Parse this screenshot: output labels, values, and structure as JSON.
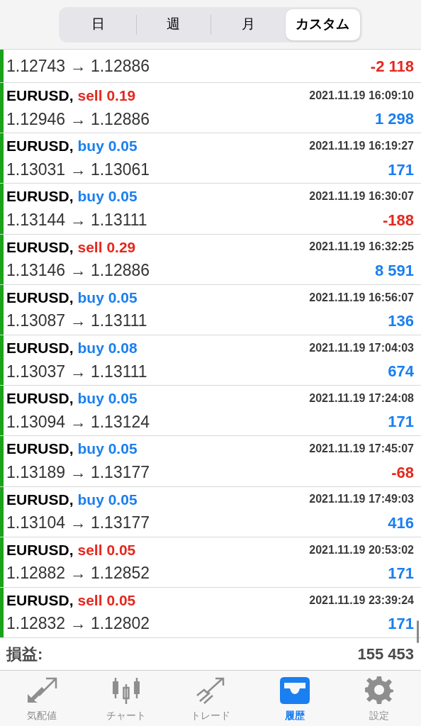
{
  "segments": [
    {
      "label": "日",
      "selected": false
    },
    {
      "label": "週",
      "selected": false
    },
    {
      "label": "月",
      "selected": false
    },
    {
      "label": "カスタム",
      "selected": true
    }
  ],
  "first_row": {
    "prices": "1.12743 → 1.12886",
    "profit": "-2 118",
    "loss": true
  },
  "trades": [
    {
      "symbol": "EURUSD,",
      "order": "sell 0.19",
      "kind": "sell",
      "time": "2021.11.19 16:09:10",
      "prices": "1.12946 → 1.12886",
      "profit": "1 298",
      "loss": false
    },
    {
      "symbol": "EURUSD,",
      "order": "buy 0.05",
      "kind": "buy",
      "time": "2021.11.19 16:19:27",
      "prices": "1.13031 → 1.13061",
      "profit": "171",
      "loss": false
    },
    {
      "symbol": "EURUSD,",
      "order": "buy 0.05",
      "kind": "buy",
      "time": "2021.11.19 16:30:07",
      "prices": "1.13144 → 1.13111",
      "profit": "-188",
      "loss": true
    },
    {
      "symbol": "EURUSD,",
      "order": "sell 0.29",
      "kind": "sell",
      "time": "2021.11.19 16:32:25",
      "prices": "1.13146 → 1.12886",
      "profit": "8 591",
      "loss": false
    },
    {
      "symbol": "EURUSD,",
      "order": "buy 0.05",
      "kind": "buy",
      "time": "2021.11.19 16:56:07",
      "prices": "1.13087 → 1.13111",
      "profit": "136",
      "loss": false
    },
    {
      "symbol": "EURUSD,",
      "order": "buy 0.08",
      "kind": "buy",
      "time": "2021.11.19 17:04:03",
      "prices": "1.13037 → 1.13111",
      "profit": "674",
      "loss": false
    },
    {
      "symbol": "EURUSD,",
      "order": "buy 0.05",
      "kind": "buy",
      "time": "2021.11.19 17:24:08",
      "prices": "1.13094 → 1.13124",
      "profit": "171",
      "loss": false
    },
    {
      "symbol": "EURUSD,",
      "order": "buy 0.05",
      "kind": "buy",
      "time": "2021.11.19 17:45:07",
      "prices": "1.13189 → 1.13177",
      "profit": "-68",
      "loss": true
    },
    {
      "symbol": "EURUSD,",
      "order": "buy 0.05",
      "kind": "buy",
      "time": "2021.11.19 17:49:03",
      "prices": "1.13104 → 1.13177",
      "profit": "416",
      "loss": false
    },
    {
      "symbol": "EURUSD,",
      "order": "sell 0.05",
      "kind": "sell",
      "time": "2021.11.19 20:53:02",
      "prices": "1.12882 → 1.12852",
      "profit": "171",
      "loss": false
    },
    {
      "symbol": "EURUSD,",
      "order": "sell 0.05",
      "kind": "sell",
      "time": "2021.11.19 23:39:24",
      "prices": "1.12832 → 1.12802",
      "profit": "171",
      "loss": false
    }
  ],
  "summary": {
    "label": "損益:",
    "value": "155 453"
  },
  "tab_bar": [
    {
      "label": "気配値",
      "kind": "quotes",
      "selected": false
    },
    {
      "label": "チャート",
      "kind": "chart",
      "selected": false
    },
    {
      "label": "トレード",
      "kind": "trade",
      "selected": false
    },
    {
      "label": "履歴",
      "kind": "history",
      "selected": true
    },
    {
      "label": "設定",
      "kind": "settings",
      "selected": false
    }
  ]
}
